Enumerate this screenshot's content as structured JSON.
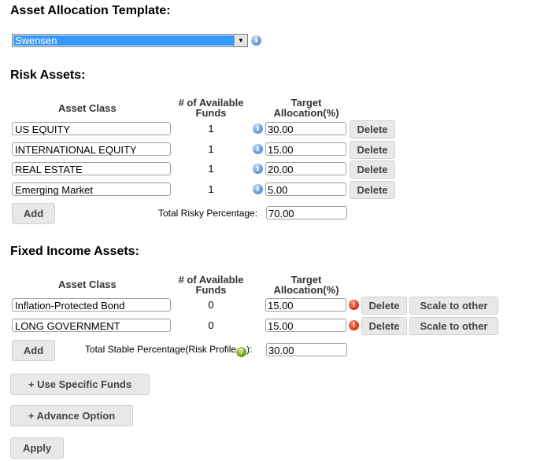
{
  "template": {
    "heading": "Asset Allocation Template:",
    "selected": "Swensen"
  },
  "risk": {
    "heading": "Risk Assets:",
    "col_asset_class": "Asset Class",
    "col_funds_line1": "# of Available",
    "col_funds_line2": "Funds",
    "col_target_line1": "Target",
    "col_target_line2": "Allocation(%)",
    "rows": [
      {
        "name": "US EQUITY",
        "funds": "1",
        "alloc": "30.00"
      },
      {
        "name": "INTERNATIONAL EQUITY",
        "funds": "1",
        "alloc": "15.00"
      },
      {
        "name": "REAL ESTATE",
        "funds": "1",
        "alloc": "20.00"
      },
      {
        "name": "Emerging Market",
        "funds": "1",
        "alloc": "5.00"
      }
    ],
    "delete_label": "Delete",
    "add_label": "Add",
    "total_label": "Total Risky Percentage:",
    "total_value": "70.00"
  },
  "fixed": {
    "heading": "Fixed Income Assets:",
    "col_asset_class": "Asset Class",
    "col_funds_line1": "# of Available",
    "col_funds_line2": "Funds",
    "col_target_line1": "Target",
    "col_target_line2": "Allocation(%)",
    "rows": [
      {
        "name": "Inflation-Protected Bond",
        "funds": "0",
        "alloc": "15.00"
      },
      {
        "name": "LONG GOVERNMENT",
        "funds": "0",
        "alloc": "15.00"
      }
    ],
    "delete_label": "Delete",
    "scale_label": "Scale to other",
    "add_label": "Add",
    "total_label_before": "Total Stable Percentage(Risk Profile",
    "total_label_after": "):",
    "total_value": "30.00"
  },
  "buttons": {
    "specific_funds": "+ Use Specific Funds",
    "advance_option": "+ Advance Option",
    "apply": "Apply"
  },
  "icons": {
    "info": "info-icon",
    "error": "error-icon",
    "help": "help-icon"
  }
}
